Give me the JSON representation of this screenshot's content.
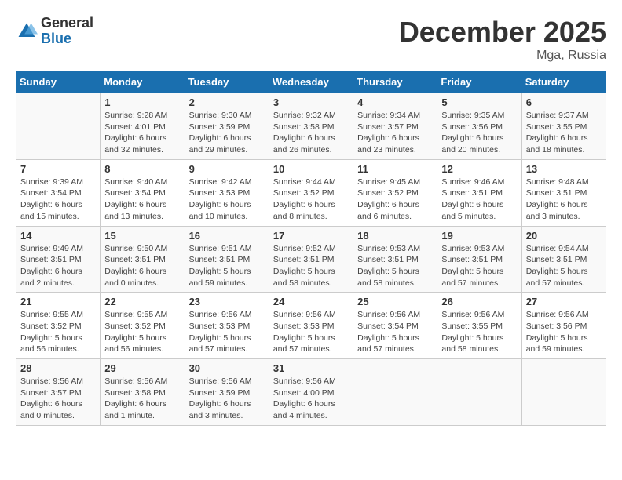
{
  "logo": {
    "general": "General",
    "blue": "Blue"
  },
  "title": "December 2025",
  "location": "Mga, Russia",
  "days_of_week": [
    "Sunday",
    "Monday",
    "Tuesday",
    "Wednesday",
    "Thursday",
    "Friday",
    "Saturday"
  ],
  "weeks": [
    [
      {
        "day": "",
        "info": ""
      },
      {
        "day": "1",
        "info": "Sunrise: 9:28 AM\nSunset: 4:01 PM\nDaylight: 6 hours\nand 32 minutes."
      },
      {
        "day": "2",
        "info": "Sunrise: 9:30 AM\nSunset: 3:59 PM\nDaylight: 6 hours\nand 29 minutes."
      },
      {
        "day": "3",
        "info": "Sunrise: 9:32 AM\nSunset: 3:58 PM\nDaylight: 6 hours\nand 26 minutes."
      },
      {
        "day": "4",
        "info": "Sunrise: 9:34 AM\nSunset: 3:57 PM\nDaylight: 6 hours\nand 23 minutes."
      },
      {
        "day": "5",
        "info": "Sunrise: 9:35 AM\nSunset: 3:56 PM\nDaylight: 6 hours\nand 20 minutes."
      },
      {
        "day": "6",
        "info": "Sunrise: 9:37 AM\nSunset: 3:55 PM\nDaylight: 6 hours\nand 18 minutes."
      }
    ],
    [
      {
        "day": "7",
        "info": "Sunrise: 9:39 AM\nSunset: 3:54 PM\nDaylight: 6 hours\nand 15 minutes."
      },
      {
        "day": "8",
        "info": "Sunrise: 9:40 AM\nSunset: 3:54 PM\nDaylight: 6 hours\nand 13 minutes."
      },
      {
        "day": "9",
        "info": "Sunrise: 9:42 AM\nSunset: 3:53 PM\nDaylight: 6 hours\nand 10 minutes."
      },
      {
        "day": "10",
        "info": "Sunrise: 9:44 AM\nSunset: 3:52 PM\nDaylight: 6 hours\nand 8 minutes."
      },
      {
        "day": "11",
        "info": "Sunrise: 9:45 AM\nSunset: 3:52 PM\nDaylight: 6 hours\nand 6 minutes."
      },
      {
        "day": "12",
        "info": "Sunrise: 9:46 AM\nSunset: 3:51 PM\nDaylight: 6 hours\nand 5 minutes."
      },
      {
        "day": "13",
        "info": "Sunrise: 9:48 AM\nSunset: 3:51 PM\nDaylight: 6 hours\nand 3 minutes."
      }
    ],
    [
      {
        "day": "14",
        "info": "Sunrise: 9:49 AM\nSunset: 3:51 PM\nDaylight: 6 hours\nand 2 minutes."
      },
      {
        "day": "15",
        "info": "Sunrise: 9:50 AM\nSunset: 3:51 PM\nDaylight: 6 hours\nand 0 minutes."
      },
      {
        "day": "16",
        "info": "Sunrise: 9:51 AM\nSunset: 3:51 PM\nDaylight: 5 hours\nand 59 minutes."
      },
      {
        "day": "17",
        "info": "Sunrise: 9:52 AM\nSunset: 3:51 PM\nDaylight: 5 hours\nand 58 minutes."
      },
      {
        "day": "18",
        "info": "Sunrise: 9:53 AM\nSunset: 3:51 PM\nDaylight: 5 hours\nand 58 minutes."
      },
      {
        "day": "19",
        "info": "Sunrise: 9:53 AM\nSunset: 3:51 PM\nDaylight: 5 hours\nand 57 minutes."
      },
      {
        "day": "20",
        "info": "Sunrise: 9:54 AM\nSunset: 3:51 PM\nDaylight: 5 hours\nand 57 minutes."
      }
    ],
    [
      {
        "day": "21",
        "info": "Sunrise: 9:55 AM\nSunset: 3:52 PM\nDaylight: 5 hours\nand 56 minutes."
      },
      {
        "day": "22",
        "info": "Sunrise: 9:55 AM\nSunset: 3:52 PM\nDaylight: 5 hours\nand 56 minutes."
      },
      {
        "day": "23",
        "info": "Sunrise: 9:56 AM\nSunset: 3:53 PM\nDaylight: 5 hours\nand 57 minutes."
      },
      {
        "day": "24",
        "info": "Sunrise: 9:56 AM\nSunset: 3:53 PM\nDaylight: 5 hours\nand 57 minutes."
      },
      {
        "day": "25",
        "info": "Sunrise: 9:56 AM\nSunset: 3:54 PM\nDaylight: 5 hours\nand 57 minutes."
      },
      {
        "day": "26",
        "info": "Sunrise: 9:56 AM\nSunset: 3:55 PM\nDaylight: 5 hours\nand 58 minutes."
      },
      {
        "day": "27",
        "info": "Sunrise: 9:56 AM\nSunset: 3:56 PM\nDaylight: 5 hours\nand 59 minutes."
      }
    ],
    [
      {
        "day": "28",
        "info": "Sunrise: 9:56 AM\nSunset: 3:57 PM\nDaylight: 6 hours\nand 0 minutes."
      },
      {
        "day": "29",
        "info": "Sunrise: 9:56 AM\nSunset: 3:58 PM\nDaylight: 6 hours\nand 1 minute."
      },
      {
        "day": "30",
        "info": "Sunrise: 9:56 AM\nSunset: 3:59 PM\nDaylight: 6 hours\nand 3 minutes."
      },
      {
        "day": "31",
        "info": "Sunrise: 9:56 AM\nSunset: 4:00 PM\nDaylight: 6 hours\nand 4 minutes."
      },
      {
        "day": "",
        "info": ""
      },
      {
        "day": "",
        "info": ""
      },
      {
        "day": "",
        "info": ""
      }
    ]
  ]
}
